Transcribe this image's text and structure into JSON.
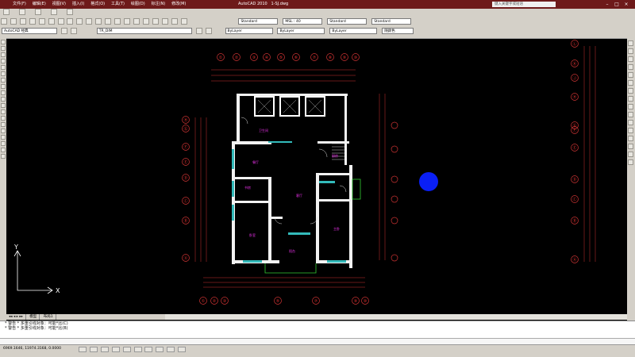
{
  "titlebar": {
    "menus": [
      "文件(F)",
      "编辑(E)",
      "视图(V)",
      "插入(I)",
      "格式(O)",
      "工具(T)",
      "绘图(D)",
      "标注(N)",
      "修改(M)"
    ],
    "app_title": "AutoCAD 2010",
    "doc_title": "1-SJ.dwg",
    "search_placeholder": "键入关键字或短语"
  },
  "toolbar": {
    "workspace": "AutoCAD 经典",
    "text_style": "Standard",
    "dim_style": "MSL : 40",
    "table_style": "Standard",
    "multileader_style": "Standard",
    "layer": "TR_DIM",
    "color": "ByLayer",
    "linetype": "ByLayer",
    "lineweight": "ByLayer",
    "plotstyle": "随颜色"
  },
  "tabs": [
    "模型",
    "布局1"
  ],
  "command_lines": [
    "* 警告 *  多重引线对象：可能*比(C)",
    "* 警告 *  多重引线对象：可能*比(B)"
  ],
  "status": {
    "coords": "6969.1646, 11974.3168, 0.0000"
  },
  "drawing": {
    "top_axes": [
      "①",
      "②",
      "③",
      "④",
      "⑤",
      "⑥",
      "⑦",
      "⑧",
      "⑨",
      "⑩"
    ],
    "bottom_axes": [
      "①",
      "②",
      "③",
      "⑤",
      "⑦",
      "⑨",
      "⑩"
    ],
    "left_axes": [
      "Ⓗ",
      "Ⓖ",
      "Ⓕ",
      "Ⓔ",
      "Ⓓ",
      "Ⓒ",
      "Ⓑ",
      "Ⓐ"
    ],
    "right_axes": [
      "Ⓛ",
      "Ⓚ",
      "Ⓙ",
      "Ⓗ",
      "Ⓖ",
      "Ⓕ",
      "Ⓔ",
      "Ⓓ",
      "Ⓒ",
      "Ⓑ",
      "Ⓐ"
    ],
    "ucs_x": "X",
    "ucs_y": "Y",
    "rooms": [
      "客厅",
      "餐厅",
      "卧室",
      "主卧",
      "厨房",
      "卫生间",
      "书房",
      "阳台"
    ]
  }
}
